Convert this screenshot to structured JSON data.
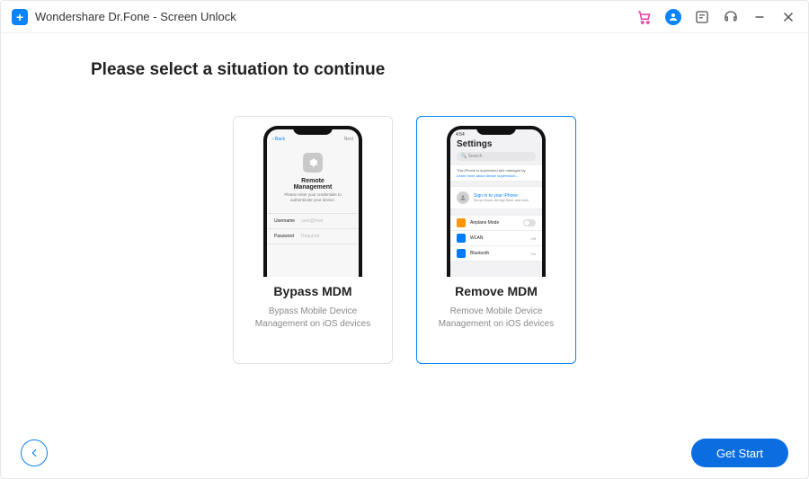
{
  "titlebar": {
    "app_title": "Wondershare Dr.Fone - Screen Unlock"
  },
  "main": {
    "heading": "Please select a situation to continue",
    "cards": [
      {
        "title": "Bypass MDM",
        "desc": "Bypass Mobile Device Management on iOS devices"
      },
      {
        "title": "Remove MDM",
        "desc": "Remove Mobile Device Management on iOS devices"
      }
    ]
  },
  "phone1": {
    "back": "‹ Back",
    "next": "Next",
    "title": "Remote\nManagement",
    "sub": "Please enter your credentials to authenticate your device.",
    "username_lbl": "Username",
    "username_ph": "user@host",
    "password_lbl": "Password",
    "password_ph": "Required"
  },
  "phone2": {
    "time": "4:54",
    "heading": "Settings",
    "search": "Search",
    "banner_line1": "This iPhone is supervised and managed by",
    "banner_link": "Learn more about device supervision…",
    "signin_title": "Sign in to your iPhone",
    "signin_sub": "Set up iCloud, the App Store, and more.",
    "items": {
      "airplane": "Airplane Mode",
      "wlan": "WLAN",
      "wlan_val": "Off",
      "bluetooth": "Bluetooth",
      "bluetooth_val": "On"
    }
  },
  "footer": {
    "primary": "Get Start"
  }
}
